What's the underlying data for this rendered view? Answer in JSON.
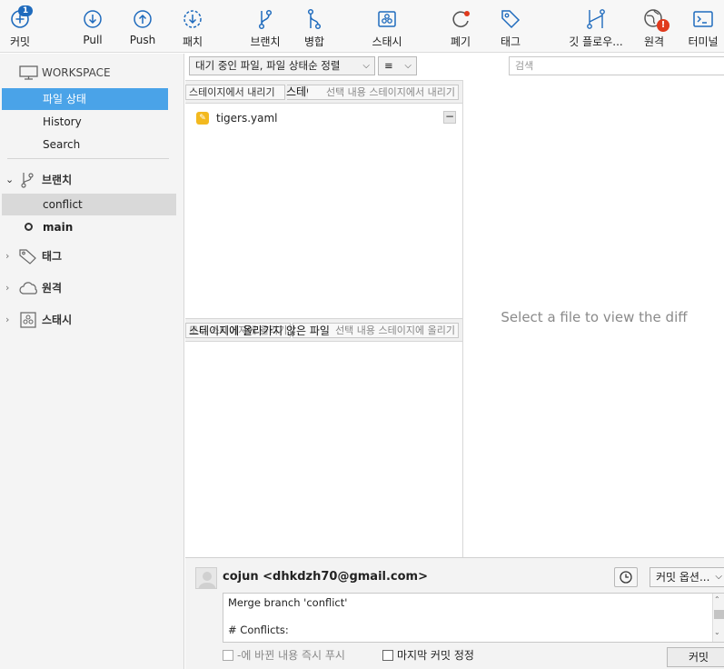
{
  "toolbar": {
    "commit": {
      "label": "커밋",
      "badge": "1"
    },
    "pull": "Pull",
    "push": "Push",
    "fetch": "패치",
    "branch": "브랜치",
    "merge": "병합",
    "stash": "스태시",
    "discard": "폐기",
    "tag": "태그",
    "gitflow": "깃 플로우...",
    "remote": {
      "label": "원격",
      "alert": "!"
    },
    "terminal": "터미널"
  },
  "sidebar": {
    "workspace_header": "WORKSPACE",
    "workspace_items": [
      "파일 상태",
      "History",
      "Search"
    ],
    "branches_header": "브랜치",
    "branches": [
      "conflict",
      "main"
    ],
    "tags_header": "태그",
    "remotes_header": "원격",
    "stashes_header": "스태시"
  },
  "filter": {
    "sort_label": "대기 중인 파일, 파일 상태순 정렬",
    "view_label": "≡",
    "search_placeholder": "검색"
  },
  "staged": {
    "title": "스테이지에 올라간 파일",
    "unstage_all": "스테이지에서 내리기",
    "unstage_selected": "선택 내용 스테이지에서 내리기",
    "files": [
      {
        "name": "tigers.yaml",
        "status": "modified"
      }
    ]
  },
  "unstaged": {
    "title": "스테이지에 올라가지 않은 파일",
    "stage_all": "모두 스테이지에 올리기",
    "stage_selected": "선택 내용 스테이지에 올리기"
  },
  "diff": {
    "placeholder": "Select a file to view the diff"
  },
  "commit": {
    "author": "cojun <dhkdzh70@gmail.com>",
    "options_label": "커밋 옵션...",
    "message": "Merge branch 'conflict'\n\n# Conflicts:",
    "push_immediately": "-에 바뀐 내용 즉시 푸시",
    "amend_last": "마지막 커밋 정정",
    "commit_button": "커밋"
  },
  "colors": {
    "accent": "#1f6bbd",
    "selected": "#4aa3e8",
    "file_modified": "#f3b91f",
    "alert": "#e03a1d"
  }
}
